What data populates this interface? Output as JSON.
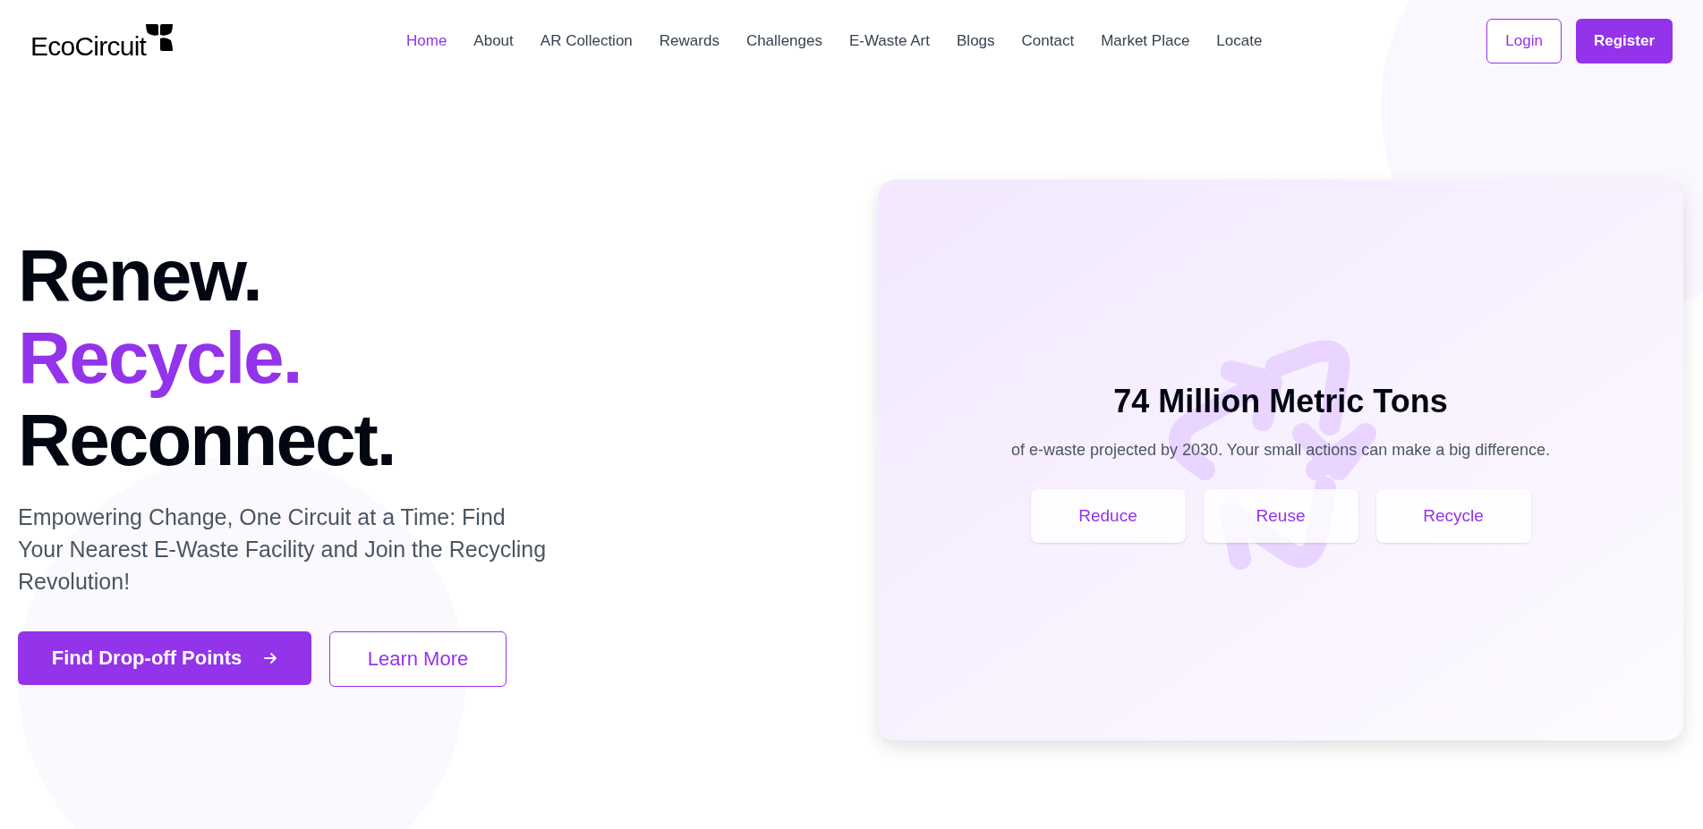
{
  "logo": {
    "text": "EcoCircuit"
  },
  "nav": [
    {
      "label": "Home",
      "selected": true
    },
    {
      "label": "About",
      "selected": false
    },
    {
      "label": "AR Collection",
      "selected": false
    },
    {
      "label": "Rewards",
      "selected": false
    },
    {
      "label": "Challenges",
      "selected": false
    },
    {
      "label": "E-Waste Art",
      "selected": false
    },
    {
      "label": "Blogs",
      "selected": false
    },
    {
      "label": "Contact",
      "selected": false
    },
    {
      "label": "Market Place",
      "selected": false
    },
    {
      "label": "Locate",
      "selected": false
    }
  ],
  "auth": {
    "login": "Login",
    "register": "Register"
  },
  "hero": {
    "headline": [
      {
        "text": "Renew.",
        "highlight": false
      },
      {
        "text": "Recycle.",
        "highlight": true
      },
      {
        "text": "Reconnect.",
        "highlight": false
      }
    ],
    "subtitle": "Empowering Change, One Circuit at a Time: Find Your Nearest E-Waste Facility and Join the Recycling Revolution!",
    "primary_button": "Find Drop-off Points",
    "secondary_button": "Learn More"
  },
  "stat_card": {
    "title": "74 Million Metric Tons",
    "text": "of e-waste projected by 2030. Your small actions can make a big difference.",
    "buttons": [
      "Reduce",
      "Reuse",
      "Recycle"
    ]
  }
}
